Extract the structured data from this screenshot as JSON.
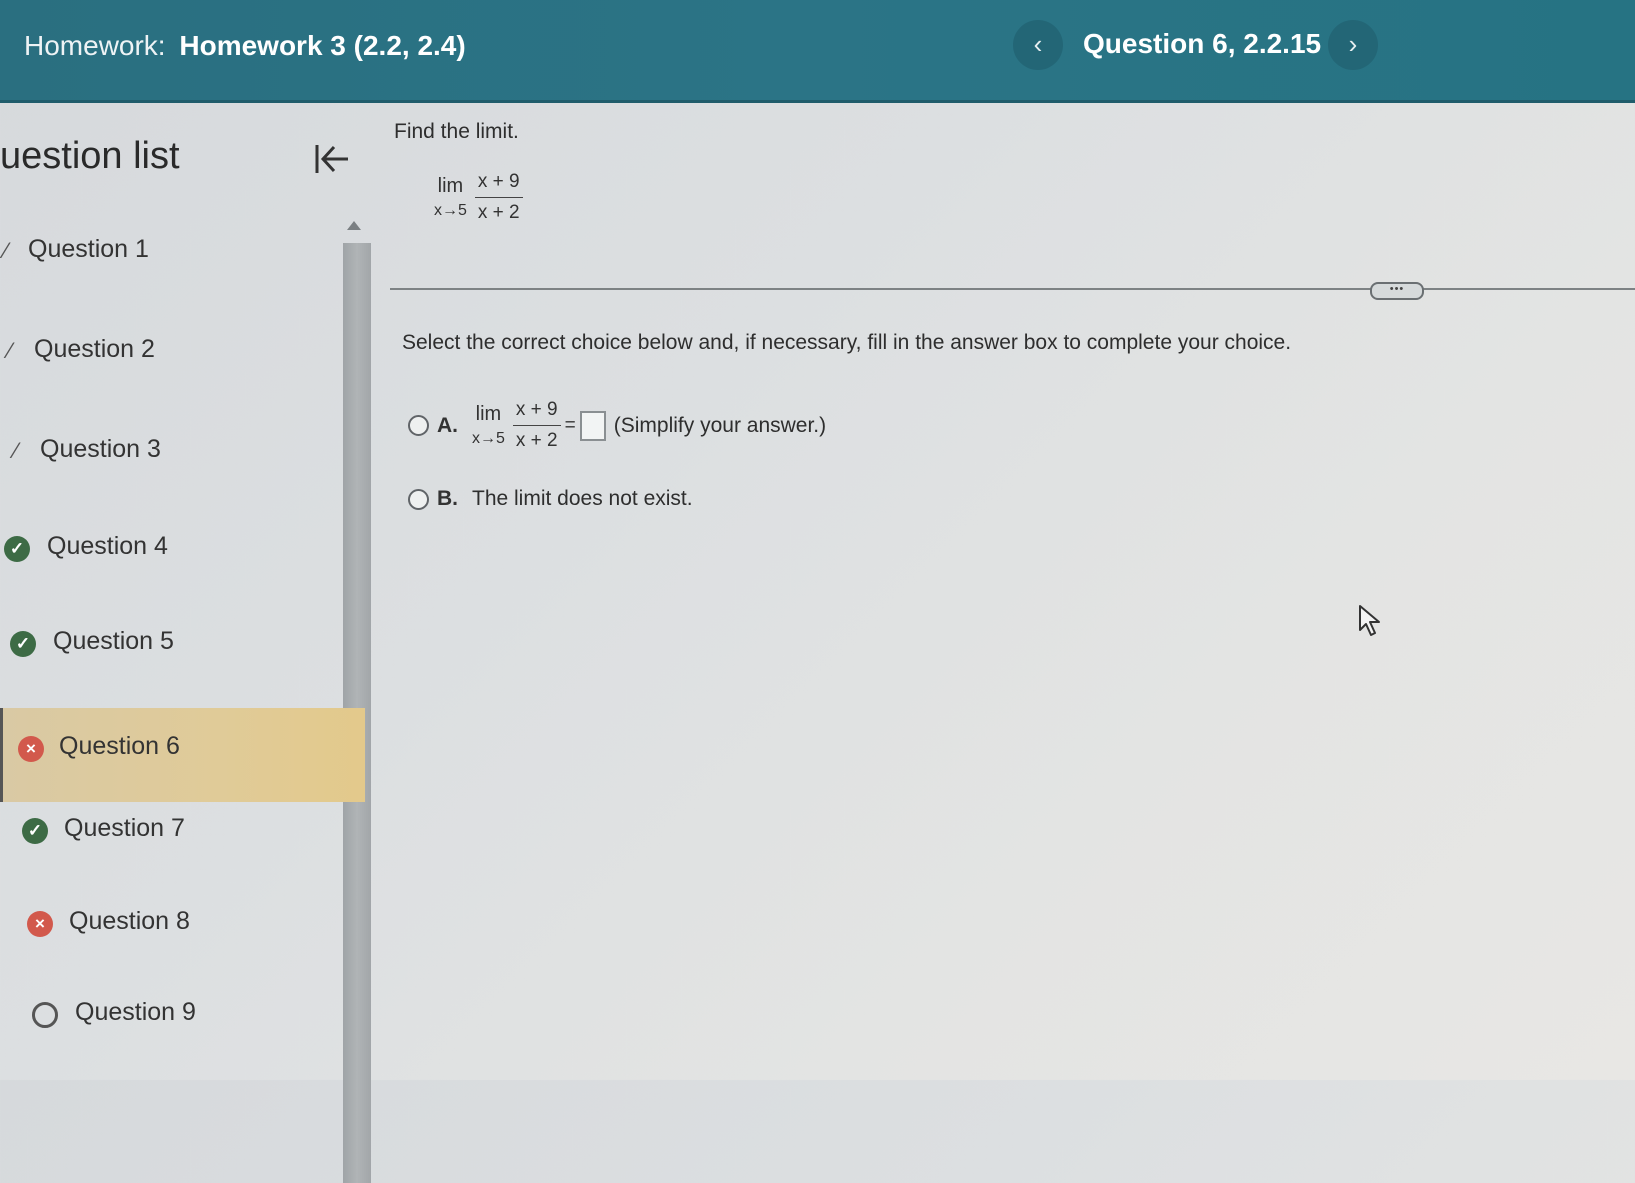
{
  "header": {
    "homework_prefix": "Homework:",
    "homework_name": "Homework 3 (2.2, 2.4)",
    "question_label": "Question 6, 2.2.15",
    "prev_icon": "chevron-left-icon",
    "next_icon": "chevron-right-icon",
    "prev_glyph": "‹",
    "next_glyph": "›"
  },
  "sidebar": {
    "title": "uestion list",
    "collapse_icon": "collapse-left-icon",
    "items": [
      {
        "label": "Question 1",
        "status": "partial"
      },
      {
        "label": "Question 2",
        "status": "partial"
      },
      {
        "label": "Question 3",
        "status": "partial"
      },
      {
        "label": "Question 4",
        "status": "correct"
      },
      {
        "label": "Question 5",
        "status": "correct"
      },
      {
        "label": "Question 6",
        "status": "incorrect",
        "current": true
      },
      {
        "label": "Question 7",
        "status": "correct"
      },
      {
        "label": "Question 8",
        "status": "incorrect"
      },
      {
        "label": "Question 9",
        "status": "not-attempted"
      }
    ]
  },
  "problem": {
    "prompt": "Find the limit.",
    "limit": {
      "lim": "lim",
      "approach": "x→5",
      "numerator": "x + 9",
      "denominator": "x + 2"
    },
    "more_label": "•••",
    "instruction": "Select the correct choice below and, if necessary, fill in the answer box to complete your choice.",
    "choices": {
      "a": {
        "letter": "A.",
        "lim": "lim",
        "approach": "x→5",
        "numerator": "x + 9",
        "denominator": "x + 2",
        "equals": "=",
        "hint": "(Simplify your answer.)"
      },
      "b": {
        "letter": "B.",
        "text": "The limit does not exist."
      }
    }
  },
  "colors": {
    "header_bg": "#2a6f80",
    "current_item_bg": "#e0cb98",
    "correct": "#3d6b45",
    "incorrect": "#d2594c"
  }
}
